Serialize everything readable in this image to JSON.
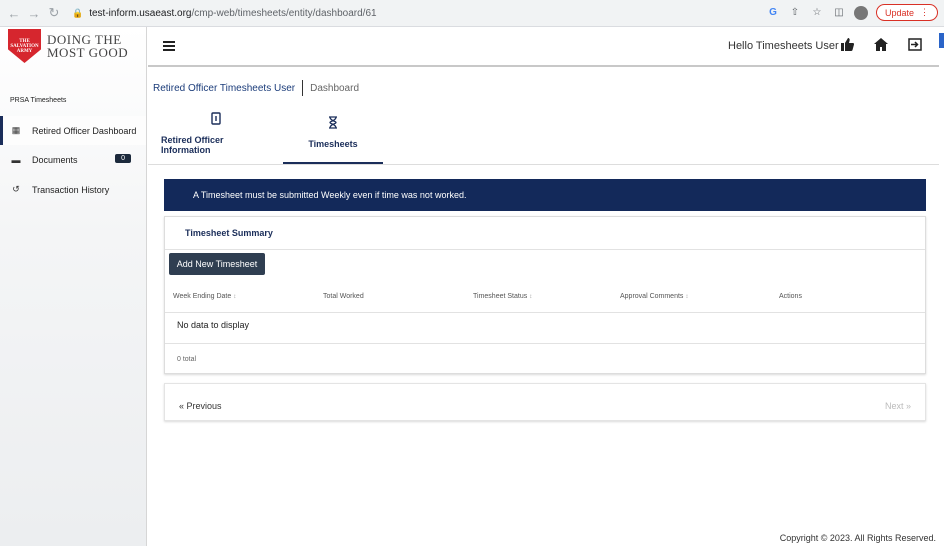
{
  "browser": {
    "url_host": "test-inform.usaeast.org",
    "url_path": "/cmp-web/timesheets/entity/dashboard/61",
    "update_label": "Update"
  },
  "brand": {
    "shield_text": "THE SALVATION ARMY",
    "logo_line1": "DOING THE",
    "logo_line2": "MOST GOOD",
    "color": "#d6262e"
  },
  "sidebar": {
    "header": "PRSA Timesheets",
    "items": [
      {
        "label": "Retired Officer Dashboard",
        "icon": "dashboard-icon",
        "active": true
      },
      {
        "label": "Documents",
        "icon": "folder-icon",
        "badge": "0"
      },
      {
        "label": "Transaction History",
        "icon": "history-icon"
      }
    ]
  },
  "header": {
    "greeting": "Hello Timesheets User",
    "icons": [
      "thumbs-up-icon",
      "home-icon",
      "logout-icon"
    ]
  },
  "breadcrumb": {
    "user": "Retired Officer Timesheets User",
    "page": "Dashboard"
  },
  "tabs": [
    {
      "label": "Retired Officer Information",
      "icon": "id-card-icon"
    },
    {
      "label": "Timesheets",
      "icon": "hourglass-icon",
      "active": true
    }
  ],
  "notice": {
    "text": "A Timesheet must be submitted Weekly even if time was not worked.",
    "color": "#13295a"
  },
  "summary": {
    "title": "Timesheet Summary",
    "add_button": "Add New Timesheet",
    "columns": [
      "Week Ending Date",
      "Total Worked",
      "Timesheet Status",
      "Approval Comments",
      "Actions"
    ],
    "empty_text": "No data to display",
    "total_text": "0 total"
  },
  "pager": {
    "previous": "« Previous",
    "next": "Next »"
  },
  "footer": {
    "copyright": "Copyright © 2023. All Rights Reserved."
  }
}
